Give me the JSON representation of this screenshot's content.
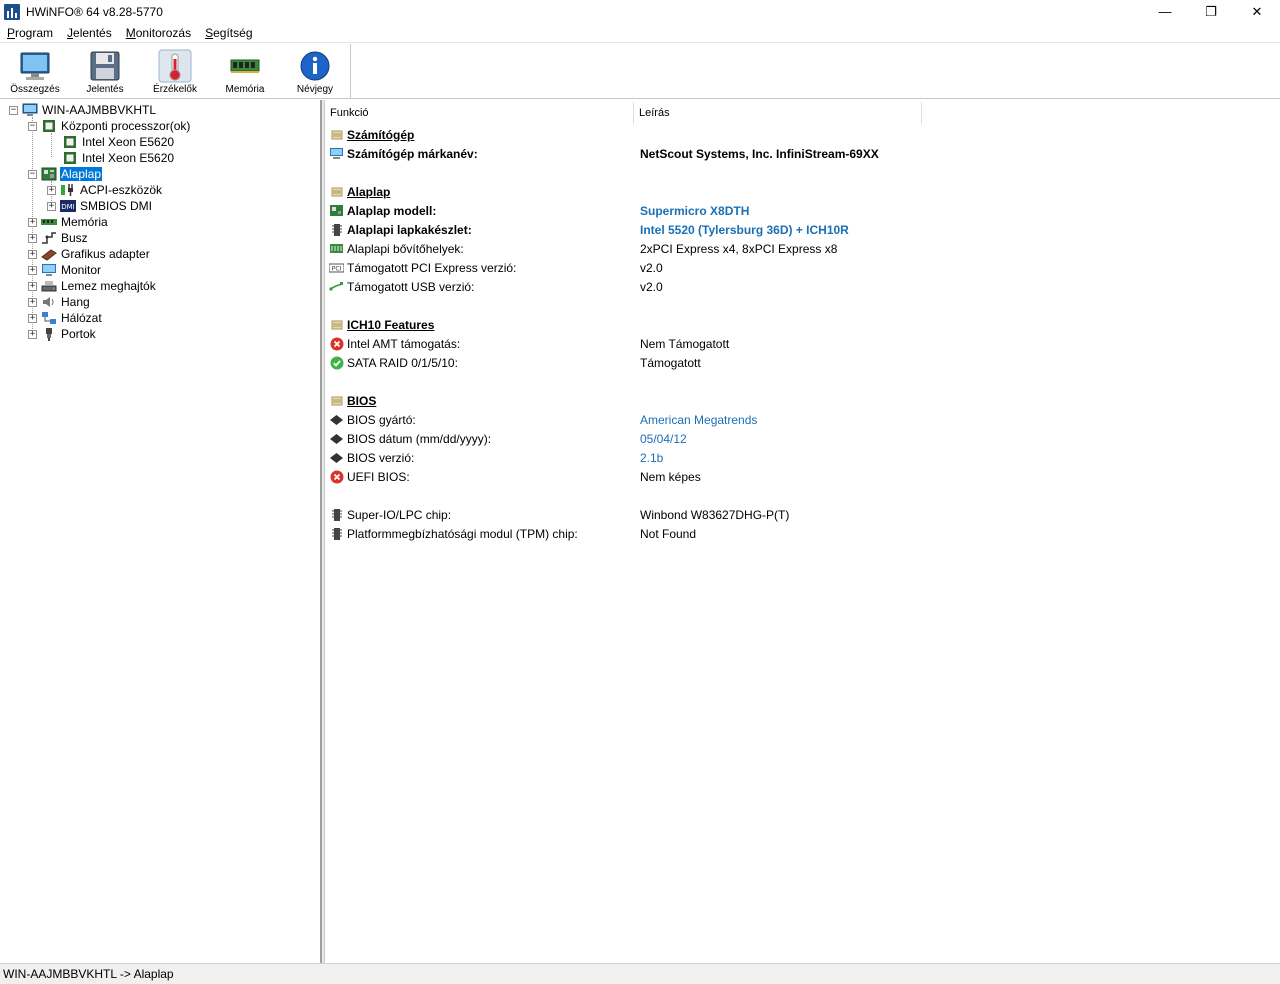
{
  "window": {
    "title": "HWiNFO® 64 v8.28-5770",
    "minimize": "—",
    "maximize": "❐",
    "close": "✕"
  },
  "menu": [
    {
      "label": "Program",
      "key": "P"
    },
    {
      "label": "Jelentés",
      "key": "J"
    },
    {
      "label": "Monitorozás",
      "key": "M"
    },
    {
      "label": "Segítség",
      "key": "S"
    }
  ],
  "toolbar": {
    "summary": "Összegzés",
    "report": "Jelentés",
    "sensors": "Érzékelők",
    "memory": "Memória",
    "about": "Névjegy"
  },
  "tree": {
    "root": "WIN-AAJMBBVKHTL",
    "cpu": "Központi processzor(ok)",
    "cpu1": "Intel Xeon E5620",
    "cpu2": "Intel Xeon E5620",
    "mobo": "Alaplap",
    "acpi": "ACPI-eszközök",
    "smbios": "SMBIOS DMI",
    "memory": "Memória",
    "bus": "Busz",
    "gpu": "Grafikus adapter",
    "monitor": "Monitor",
    "drives": "Lemez meghajtók",
    "audio": "Hang",
    "network": "Hálózat",
    "ports": "Portok"
  },
  "columns": {
    "feature": "Funkció",
    "description": "Leírás"
  },
  "details": {
    "s_computer": "Számítógép",
    "computer_brand_label": "Számítógép márkanév:",
    "computer_brand_value": "NetScout Systems, Inc. InfiniStream-69XX",
    "s_mobo": "Alaplap",
    "mobo_model_label": "Alaplap modell:",
    "mobo_model_value": "Supermicro X8DTH",
    "chipset_label": "Alaplapi lapkakészlet:",
    "chipset_value": "Intel 5520 (Tylersburg 36D) + ICH10R",
    "slots_label": "Alaplapi bővítőhelyek:",
    "slots_value": "2xPCI Express x4, 8xPCI Express x8",
    "pcie_label": "Támogatott PCI Express verzió:",
    "pcie_value": "v2.0",
    "usb_label": "Támogatott USB verzió:",
    "usb_value": "v2.0",
    "s_ich": "ICH10 Features",
    "amt_label": "Intel AMT támogatás:",
    "amt_value": "Nem Támogatott",
    "raid_label": "SATA RAID 0/1/5/10:",
    "raid_value": "Támogatott",
    "s_bios": "BIOS",
    "bios_vendor_label": "BIOS gyártó:",
    "bios_vendor_value": "American Megatrends",
    "bios_date_label": "BIOS dátum (mm/dd/yyyy):",
    "bios_date_value": "05/04/12",
    "bios_version_label": "BIOS verzió:",
    "bios_version_value": "2.1b",
    "uefi_label": "UEFI BIOS:",
    "uefi_value": "Nem képes",
    "superio_label": "Super-IO/LPC chip:",
    "superio_value": "Winbond W83627DHG-P(T)",
    "tpm_label": "Platformmegbízhatósági modul (TPM) chip:",
    "tpm_value": "Not Found"
  },
  "status": "WIN-AAJMBBVKHTL -> Alaplap",
  "colors": {
    "link": "#1b6fb5",
    "selection": "#0078d7"
  }
}
